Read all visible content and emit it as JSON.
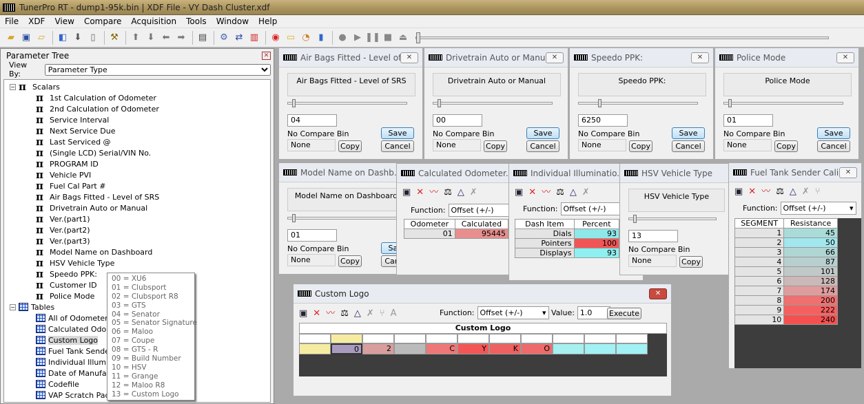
{
  "app": {
    "title": "TunerPro RT - dump1-95k.bin | XDF File - VY Dash Cluster.xdf"
  },
  "menu": [
    "File",
    "XDF",
    "View",
    "Compare",
    "Acquisition",
    "Tools",
    "Window",
    "Help"
  ],
  "toolbar_icons": [
    "open-folder",
    "save",
    "open-file",
    "export",
    "down-arrow",
    "blank-doc",
    "tool",
    "up-arrow",
    "down-arrow",
    "left",
    "right",
    "chip",
    "settings",
    "swap",
    "compare",
    "stop-red",
    "folder",
    "gauge",
    "chart",
    "record",
    "play",
    "pause",
    "stop",
    "eject"
  ],
  "tree": {
    "title": "Parameter Tree",
    "view_by_label": "View By:",
    "view_by_value": "Parameter Type",
    "scalars_label": "Scalars",
    "scalars": [
      "1st Calculation of Odometer",
      "2nd Calculation of Odometer",
      "Service Interval",
      "Next Service Due",
      "Last Serviced @",
      "(Single LCD) Serial/VIN No.",
      "PROGRAM ID",
      "Vehicle PVI",
      "Fuel Cal Part #",
      "Air Bags Fitted - Level of SRS",
      "Drivetrain Auto or Manual",
      "Ver.(part1)",
      "Ver.(part2)",
      "Ver.(part3)",
      "Model Name on Dashboard",
      "HSV Vehicle Type",
      "Speedo PPK:",
      "Customer ID",
      "Police Mode"
    ],
    "tables_label": "Tables",
    "tables": [
      "All of Odometer re",
      "Calculated Odome",
      "Custom Logo",
      "Fuel Tank Sender",
      "Individual Illumina",
      "Date of Manufact",
      "Codefile",
      "VAP Scratch Pad"
    ],
    "selected": "Custom Logo"
  },
  "popup": [
    "00 = XU6",
    "01 = Clubsport",
    "02 = Clubsport R8",
    "03 = GTS",
    "04 = Senator",
    "05 = Senator Signature",
    "06 = Maloo",
    "07 = Coupe",
    "08 = GTS - R",
    "09 = Build Number",
    "10 = HSV",
    "11 = Grange",
    "12 = Maloo R8",
    "13 = Custom Logo"
  ],
  "common": {
    "no_compare": "No Compare Bin",
    "none": "None",
    "copy": "Copy",
    "save": "Save",
    "cancel": "Cancel",
    "function_label": "Function:",
    "function_value": "Offset (+/-)",
    "value_label": "Value:",
    "value": "1.0",
    "execute": "Execute"
  },
  "scalar_windows": [
    {
      "title": "Air Bags Fitted - Level of...",
      "desc": "Air Bags Fitted - Level of SRS",
      "value": "04"
    },
    {
      "title": "Drivetrain Auto or Manual",
      "desc": "Drivetrain Auto or Manual",
      "value": "00"
    },
    {
      "title": "Speedo PPK:",
      "desc": "Speedo PPK:",
      "value": "6250"
    },
    {
      "title": "Police Mode",
      "desc": "Police Mode",
      "value": "01"
    },
    {
      "title": "Model Name on Dashb...",
      "desc": "Model Name on Dashboard",
      "value": "01"
    },
    {
      "title": "HSV Vehicle Type",
      "desc": "HSV Vehicle Type",
      "value": "13"
    }
  ],
  "odometer": {
    "title": "Calculated Odometer...",
    "headers": [
      "Odometer",
      "Calculated"
    ],
    "row": [
      "01",
      "95445"
    ]
  },
  "illum": {
    "title": "Individual Illuminatio...",
    "headers": [
      "Dash Item",
      "Percent"
    ],
    "rows": [
      [
        "Dials",
        "93"
      ],
      [
        "Pointers",
        "100"
      ],
      [
        "Displays",
        "93"
      ]
    ],
    "colors": [
      "#8ee8ea",
      "#f25555",
      "#8ef0f0"
    ]
  },
  "fuel": {
    "title": "Fuel Tank Sender Cali...",
    "headers": [
      "SEGMENT",
      "Resistance"
    ],
    "rows": [
      [
        "1",
        "45"
      ],
      [
        "2",
        "50"
      ],
      [
        "3",
        "66"
      ],
      [
        "4",
        "87"
      ],
      [
        "5",
        "101"
      ],
      [
        "6",
        "128"
      ],
      [
        "7",
        "174"
      ],
      [
        "8",
        "200"
      ],
      [
        "9",
        "222"
      ],
      [
        "10",
        "240"
      ]
    ],
    "colors": [
      "#a9dcd8",
      "#a2e6ee",
      "#b0d6d4",
      "#b8cfcf",
      "#c1c8c8",
      "#ccb8b8",
      "#e09c9c",
      "#ee7070",
      "#f46060",
      "#f55050"
    ]
  },
  "logo": {
    "title": "Custom Logo",
    "header": "Custom Logo",
    "cells": [
      "",
      "0",
      "2",
      "",
      "C",
      "Y",
      "K",
      "O",
      "",
      "",
      ""
    ],
    "colors": [
      "#f6eca1",
      "#a99bbf",
      "#d89d9d",
      "#bbbbbb",
      "#ef7777",
      "#f45555",
      "#ef6060",
      "#ef6a6a",
      "#a6f0f0",
      "#a2f1f4",
      "#a2f1f4"
    ],
    "top_colors": [
      "#f6eca1"
    ]
  }
}
